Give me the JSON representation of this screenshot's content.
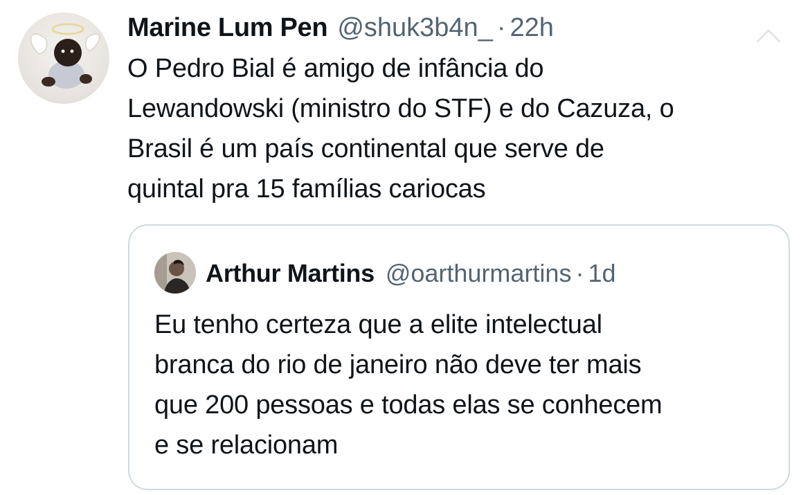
{
  "tweet": {
    "author": {
      "display_name": "Marine Lum Pen",
      "handle": "@shuk3b4n_",
      "time": "22h",
      "avatar_icon": "cherub-baby-avatar"
    },
    "separator": "·",
    "text": "O Pedro Bial é amigo de infância do\nLewandowski (ministro do STF) e do Cazuza, o\nBrasil é um país continental que serve de\nquintal pra 15 famílias cariocas",
    "more_icon": "more-options-icon"
  },
  "quoted_tweet": {
    "author": {
      "display_name": "Arthur Martins",
      "handle": "@oarthurmartins",
      "time": "1d",
      "avatar_icon": "person-photo-avatar"
    },
    "separator": "·",
    "text": "Eu tenho certeza que a elite intelectual\nbranca do rio de janeiro não deve ter mais\nque 200 pessoas e todas elas se conhecem\ne se relacionam"
  },
  "colors": {
    "text_primary": "#0f1419",
    "text_secondary": "#536471",
    "border": "#cfd9de",
    "background": "#ffffff"
  }
}
